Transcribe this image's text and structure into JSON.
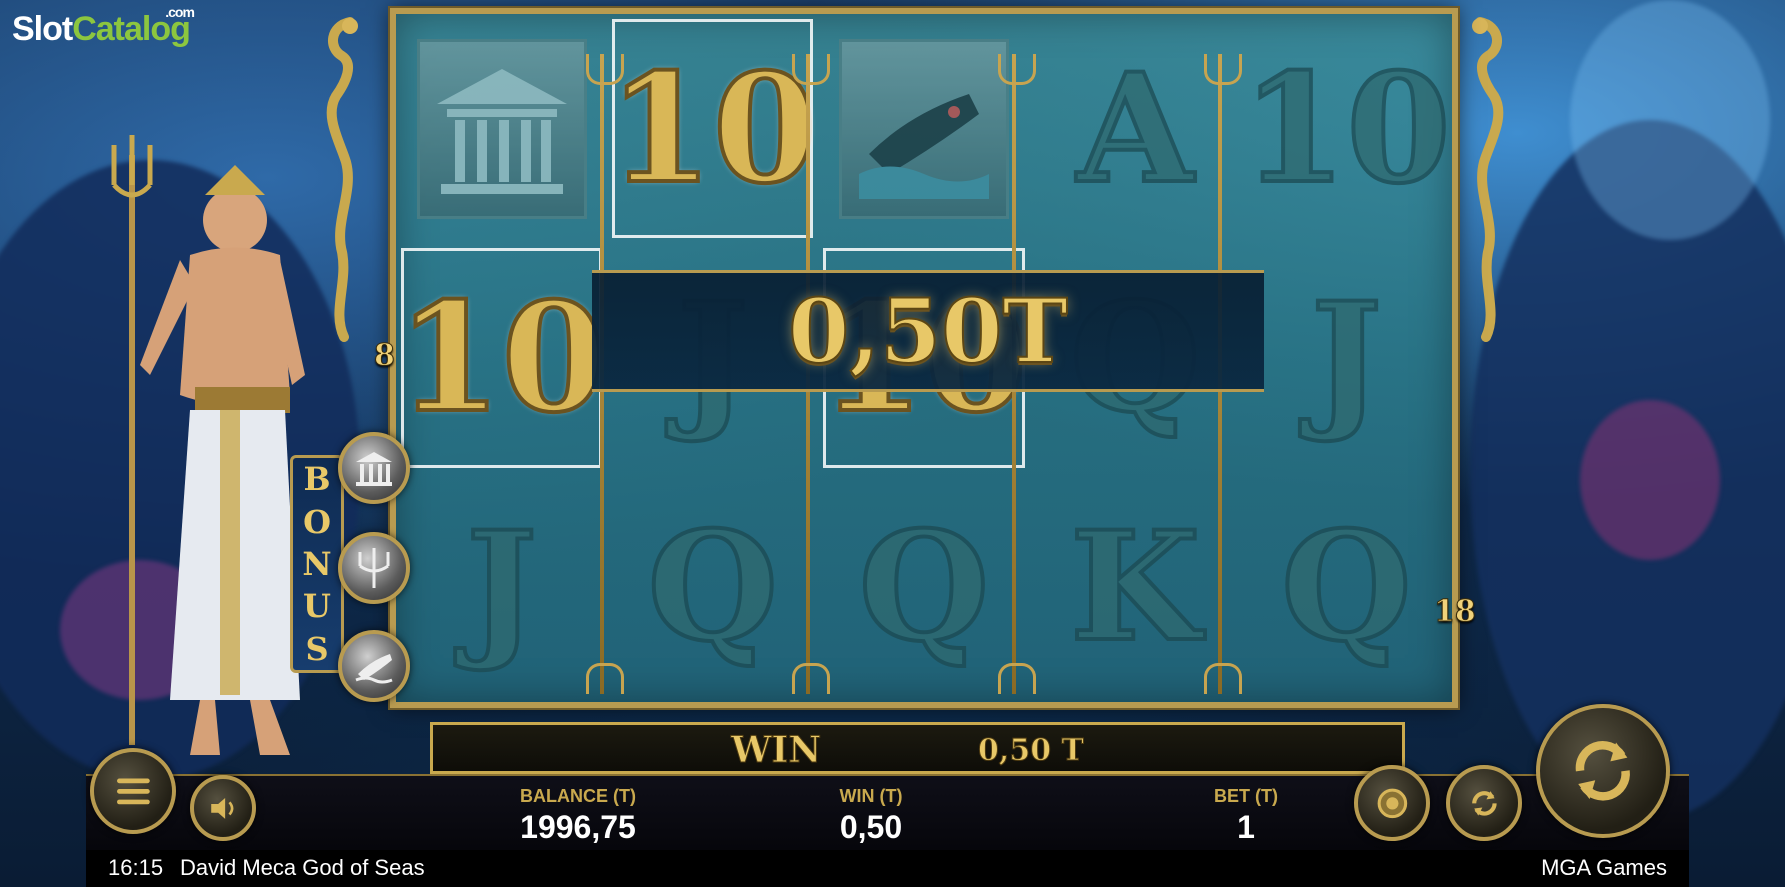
{
  "logo": {
    "main": "Slot",
    "accent": "Catalog",
    "suffix": ".com"
  },
  "reels": {
    "rows": [
      [
        {
          "symbol": "temple",
          "kind": "picture",
          "win": false
        },
        {
          "symbol": "10",
          "kind": "letter",
          "win": true
        },
        {
          "symbol": "ship",
          "kind": "picture",
          "win": false
        },
        {
          "symbol": "A",
          "kind": "letter",
          "win": false
        },
        {
          "symbol": "10",
          "kind": "letter",
          "win": false
        }
      ],
      [
        {
          "symbol": "10",
          "kind": "letter",
          "win": true
        },
        {
          "symbol": "J",
          "kind": "letter",
          "win": false
        },
        {
          "symbol": "10",
          "kind": "letter",
          "win": true
        },
        {
          "symbol": "Q",
          "kind": "letter",
          "win": false
        },
        {
          "symbol": "J",
          "kind": "letter",
          "win": false
        }
      ],
      [
        {
          "symbol": "J",
          "kind": "letter",
          "win": false
        },
        {
          "symbol": "Q",
          "kind": "letter",
          "win": false
        },
        {
          "symbol": "Q",
          "kind": "letter",
          "win": false
        },
        {
          "symbol": "K",
          "kind": "letter",
          "win": false
        },
        {
          "symbol": "Q",
          "kind": "letter",
          "win": false
        }
      ]
    ]
  },
  "win_banner": {
    "amount": "0,50T"
  },
  "paylines": {
    "left": "8",
    "right": "18"
  },
  "bonus": {
    "letters": [
      "B",
      "O",
      "N",
      "U",
      "S"
    ],
    "coins": [
      "temple-icon",
      "trident-icon",
      "ship-icon"
    ]
  },
  "win_bar": {
    "label": "WIN",
    "value": "0,50 T"
  },
  "stats": {
    "balance": {
      "label": "BALANCE (T)",
      "value": "1996,75"
    },
    "win": {
      "label": "WIN (T)",
      "value": "0,50"
    },
    "bet": {
      "label": "BET (T)",
      "value": "1"
    }
  },
  "footer": {
    "time": "16:15",
    "title": "David Meca God of Seas",
    "provider": "MGA Games"
  },
  "colors": {
    "gold": "#e8c868",
    "frame": "#b89b50",
    "water": "#2f7a86",
    "logo_green": "#8cc63f"
  }
}
